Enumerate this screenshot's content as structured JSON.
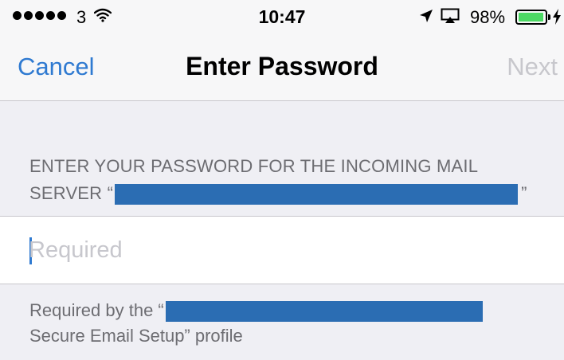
{
  "status_bar": {
    "signal_bars": 5,
    "carrier": "3",
    "time": "10:47",
    "battery_percent": "98%",
    "battery_level": 0.98,
    "battery_color": "#4cd964",
    "icons": [
      "signal-dots-icon",
      "wifi-icon",
      "location-icon",
      "airplay-icon",
      "battery-icon",
      "charging-icon"
    ]
  },
  "nav": {
    "cancel_label": "Cancel",
    "title": "Enter Password",
    "next_label": "Next",
    "accent_color": "#2f7ad1",
    "disabled_color": "#c7c7cc"
  },
  "section": {
    "header_line1": "ENTER YOUR PASSWORD FOR THE INCOMING MAIL",
    "header_line2_prefix": "SERVER “",
    "header_line2_suffix": "”"
  },
  "password_field": {
    "value": "",
    "placeholder": "Required"
  },
  "footer": {
    "line1_prefix": "Required by the “",
    "line2": "Secure Email Setup” profile"
  },
  "redaction_color": "#2b6db3"
}
